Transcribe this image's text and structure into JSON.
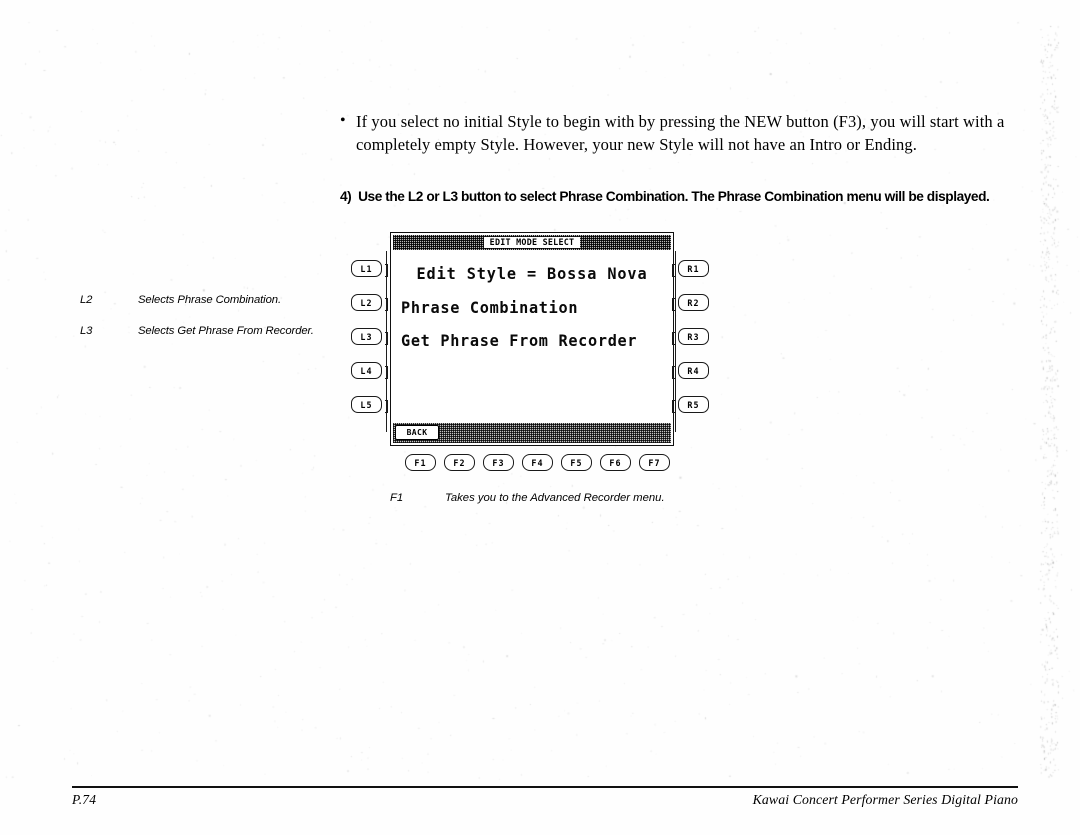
{
  "document": {
    "bullet": {
      "marker": "•",
      "text": "If you select no initial Style to begin with by pressing the NEW button (F3), you will start with a completely empty Style.   However, your new Style will not have an Intro or Ending."
    },
    "step": {
      "number": "4)",
      "text": "Use the L2 or L3 button to select Phrase Combination. The Phrase Combination menu will be displayed."
    },
    "margin_notes": [
      {
        "key": "L2",
        "description": "Selects Phrase Combination."
      },
      {
        "key": "L3",
        "description": "Selects Get Phrase From Recorder."
      }
    ],
    "diagram_caption": {
      "key": "F1",
      "description": "Takes you to the Advanced Recorder menu."
    },
    "footer": {
      "page": "P.74",
      "product": "Kawai Concert Performer Series Digital Piano"
    }
  },
  "device": {
    "lcd": {
      "titlebar_label": "EDIT MODE SELECT",
      "title_line": "Edit Style = Bossa Nova",
      "menu_items": [
        "Phrase Combination",
        "Get Phrase From Recorder"
      ],
      "back_label": "BACK"
    },
    "left_buttons": [
      {
        "label": "L1"
      },
      {
        "label": "L2"
      },
      {
        "label": "L3"
      },
      {
        "label": "L4"
      },
      {
        "label": "L5"
      }
    ],
    "right_buttons": [
      {
        "label": "R1"
      },
      {
        "label": "R2"
      },
      {
        "label": "R3"
      },
      {
        "label": "R4"
      },
      {
        "label": "R5"
      }
    ],
    "function_buttons": [
      {
        "label": "F1"
      },
      {
        "label": "F2"
      },
      {
        "label": "F3"
      },
      {
        "label": "F4"
      },
      {
        "label": "F5"
      },
      {
        "label": "F6"
      },
      {
        "label": "F7"
      }
    ]
  },
  "colors": {
    "ink": "#000000",
    "paper": "#fefefe",
    "dither_gray": "#b9b9b9"
  }
}
